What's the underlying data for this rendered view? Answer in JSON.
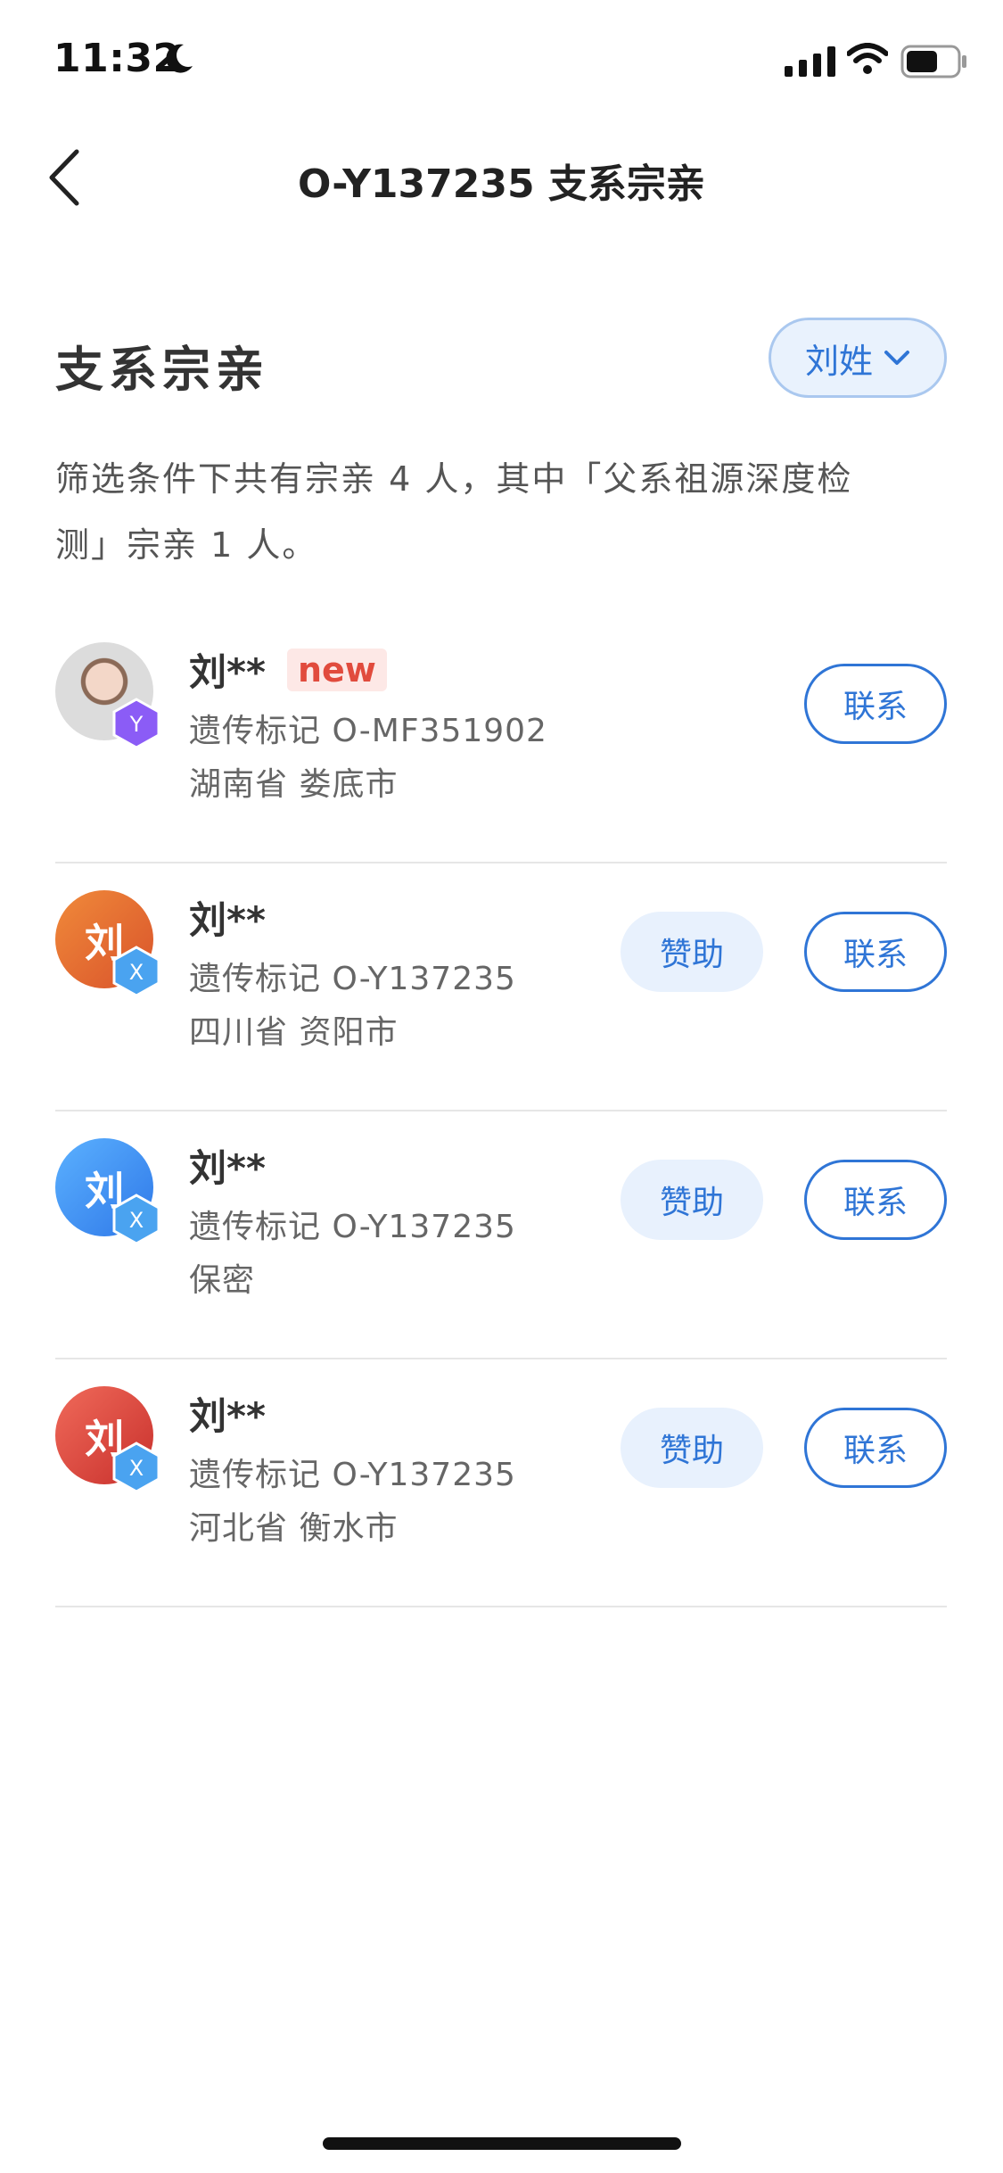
{
  "status_bar": {
    "time": "11:32"
  },
  "nav": {
    "title": "O-Y137235 支系宗亲"
  },
  "section": {
    "title": "支系宗亲",
    "filter_label": "刘姓"
  },
  "summary": {
    "line1": "筛选条件下共有宗亲 4 人，其中「父系祖源深度检",
    "line2": "测」宗亲 1 人。"
  },
  "relatives": [
    {
      "name": "刘**",
      "avatar_text": "",
      "badge_letter": "Y",
      "new_label": "new",
      "marker": "遗传标记 O-MF351902",
      "location": "湖南省 娄底市",
      "sponsor_label": "",
      "contact_label": "联系"
    },
    {
      "name": "刘**",
      "avatar_text": "刘",
      "badge_letter": "X",
      "marker": "遗传标记 O-Y137235",
      "location": "四川省 资阳市",
      "sponsor_label": "赞助",
      "contact_label": "联系"
    },
    {
      "name": "刘**",
      "avatar_text": "刘",
      "badge_letter": "X",
      "marker": "遗传标记 O-Y137235",
      "location": "保密",
      "sponsor_label": "赞助",
      "contact_label": "联系"
    },
    {
      "name": "刘**",
      "avatar_text": "刘",
      "badge_letter": "X",
      "marker": "遗传标记 O-Y137235",
      "location": "河北省 衡水市",
      "sponsor_label": "赞助",
      "contact_label": "联系"
    }
  ],
  "colors": {
    "accent": "#2f75d6",
    "new_badge": "#e14b3d"
  }
}
